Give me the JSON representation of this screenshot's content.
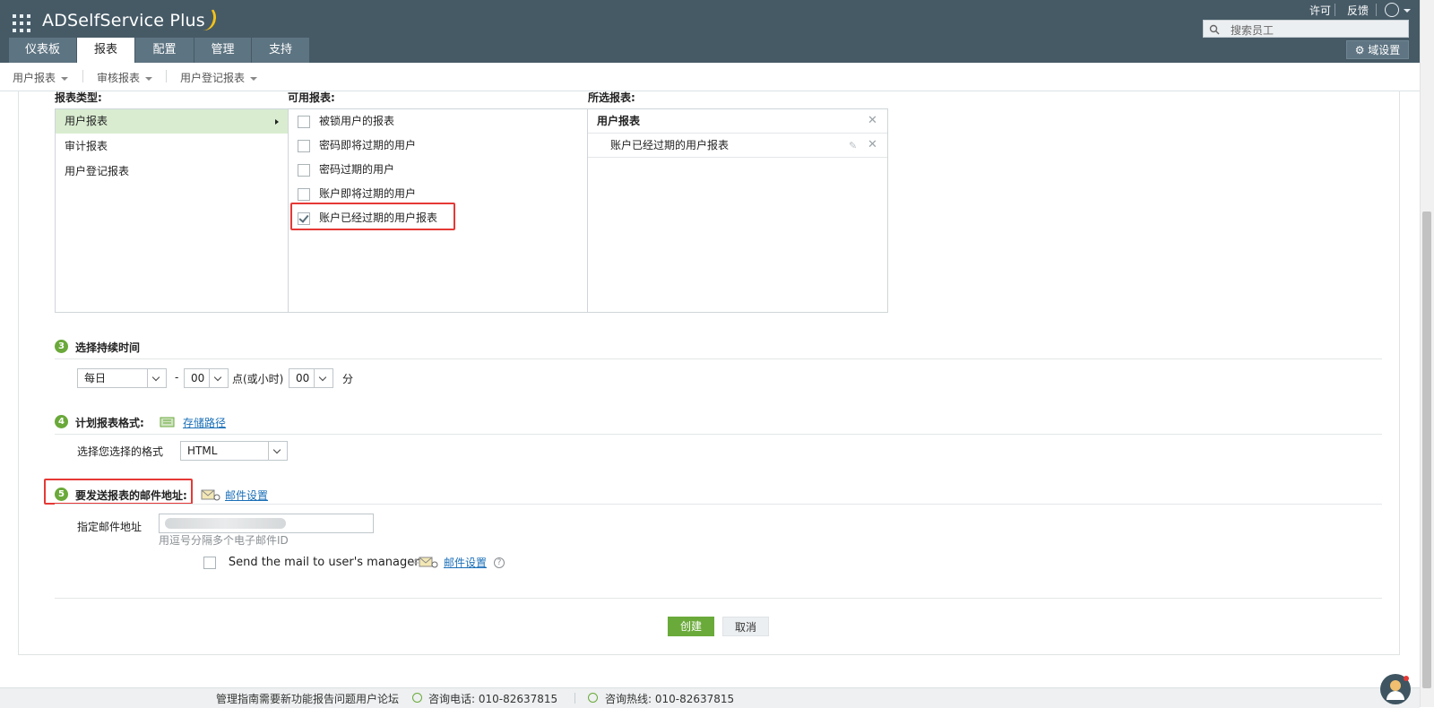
{
  "header": {
    "app_name": "ADSelfService Plus",
    "links": {
      "license": "许可",
      "feedback": "反馈"
    },
    "search_placeholder": "搜索员工",
    "tabs": [
      "仪表板",
      "报表",
      "配置",
      "管理",
      "支持"
    ],
    "active_tab": "报表",
    "domain_settings": "域设置"
  },
  "subnav": {
    "items": [
      "用户报表",
      "审核报表",
      "用户登记报表"
    ]
  },
  "report_selection": {
    "type_label": "报表类型:",
    "available_label": "可用报表:",
    "selected_label": "所选报表:",
    "types": [
      "用户报表",
      "审计报表",
      "用户登记报表"
    ],
    "available": [
      "被锁用户的报表",
      "密码即将过期的用户",
      "密码过期的用户",
      "账户即将过期的用户",
      "账户已经过期的用户报表"
    ],
    "selected_group": "用户报表",
    "selected_items": [
      "账户已经过期的用户报表"
    ]
  },
  "section3": {
    "num": "3",
    "title": "选择持续时间",
    "frequency": "每日",
    "dash": "-",
    "hour": "00",
    "hour_label": "点(或小时)",
    "minute": "00",
    "minute_label": "分"
  },
  "section4": {
    "num": "4",
    "title": "计划报表格式:",
    "storage_link": "存储路径",
    "format_label": "选择您选择的格式",
    "format_value": "HTML"
  },
  "section5": {
    "num": "5",
    "title": "要发送报表的邮件地址:",
    "mail_settings_link": "邮件设置",
    "email_label": "指定邮件地址",
    "email_hint": "用逗号分隔多个电子邮件ID",
    "manager_checkbox_label": "Send the mail to user's manager.",
    "manager_mail_settings_link": "邮件设置"
  },
  "actions": {
    "create": "创建",
    "cancel": "取消"
  },
  "footer": {
    "links": "管理指南需要新功能报告问题用户论坛",
    "phone_label": "咨询电话: 010-82637815",
    "hotline_label": "咨询热线: 010-82637815"
  },
  "colors": {
    "header_bg": "#465a66",
    "accent_green": "#6aaa3a",
    "highlight_red": "#e53935",
    "link_blue": "#1a6fb7"
  }
}
